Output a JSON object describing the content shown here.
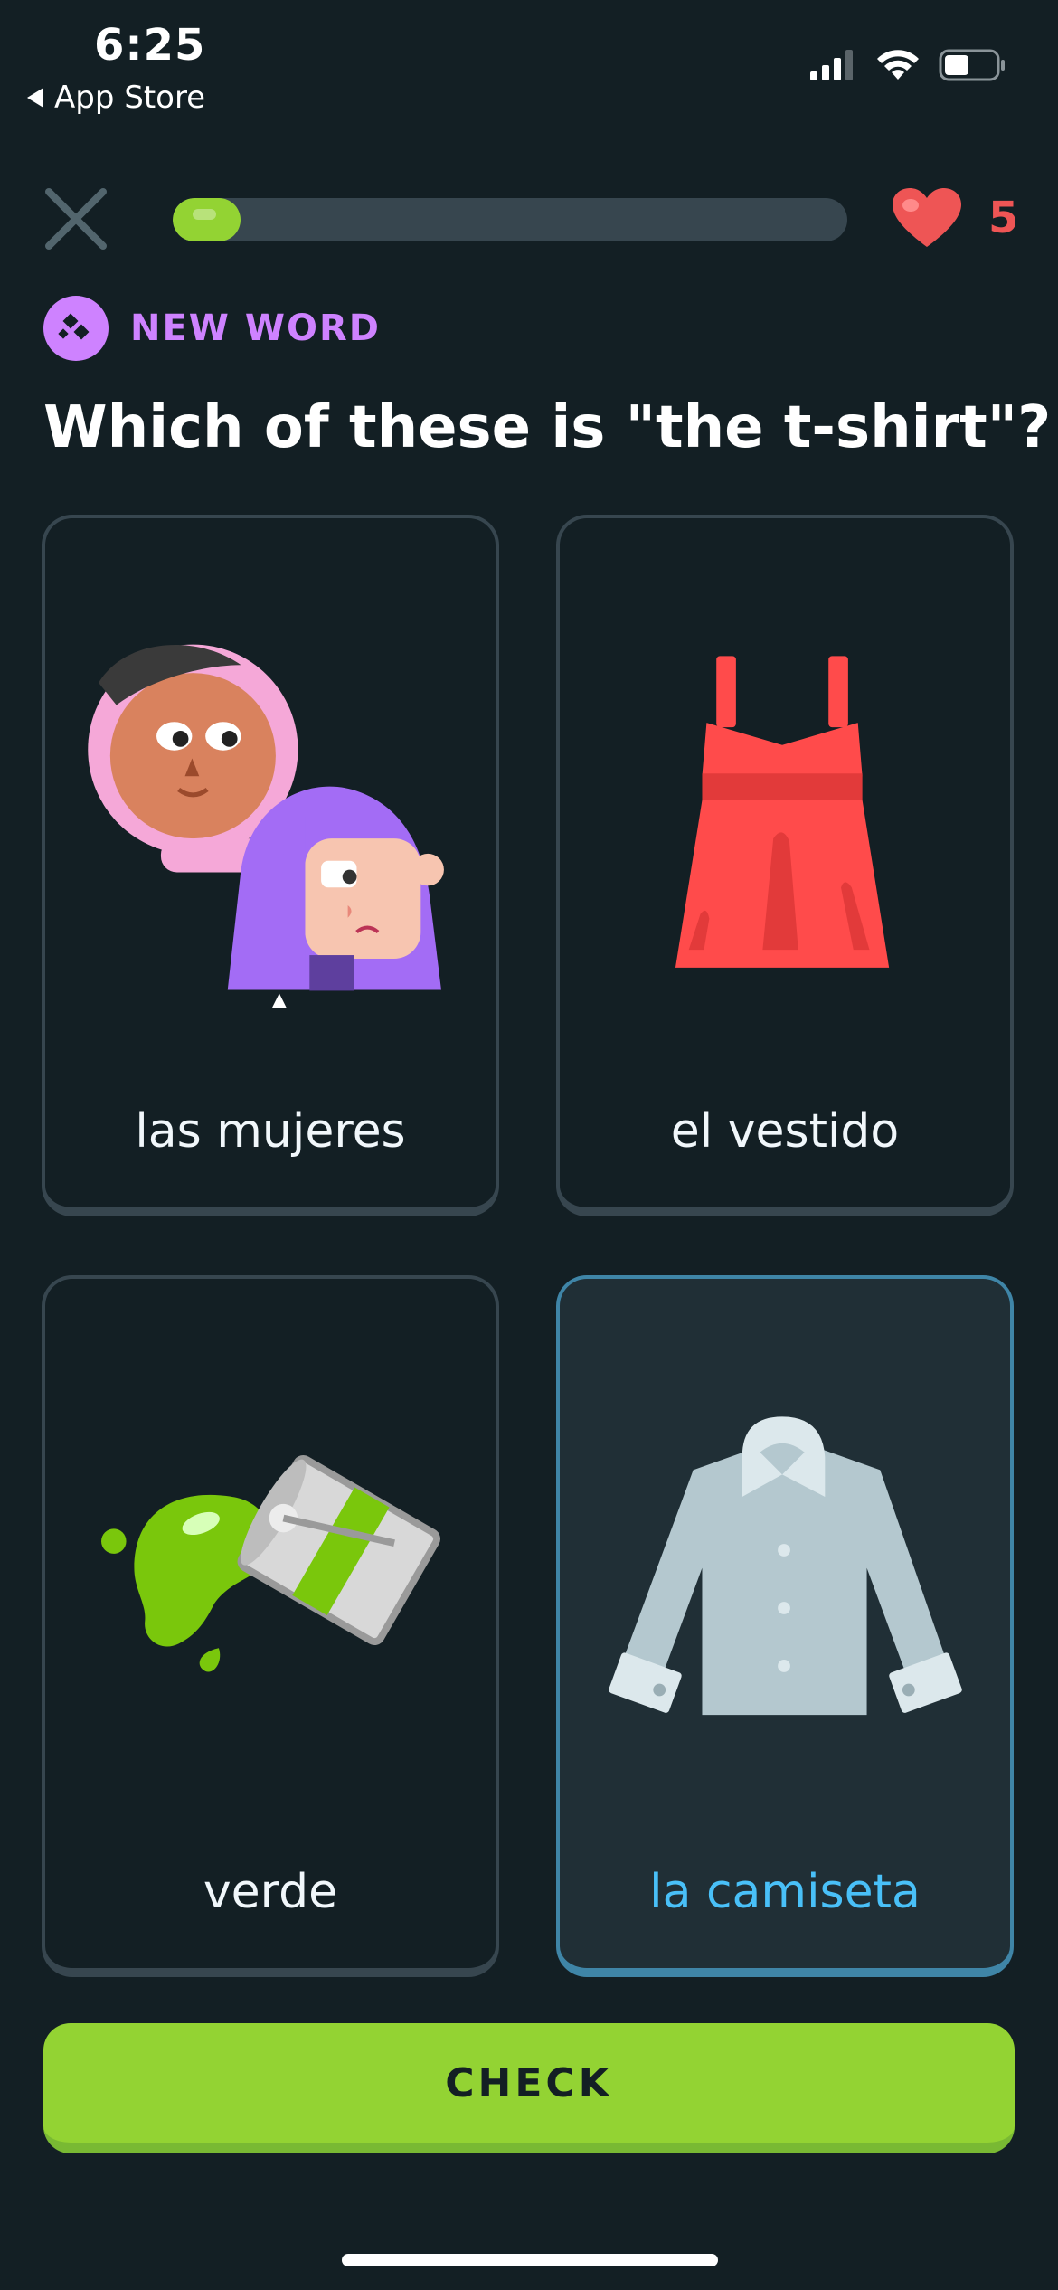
{
  "status_bar": {
    "time": "6:25",
    "back_label": "App Store",
    "icons": [
      "cellular-signal-icon",
      "wifi-icon",
      "battery-icon"
    ]
  },
  "header": {
    "close_icon": "close-icon",
    "progress": 0.1,
    "hearts_icon": "heart-icon",
    "hearts_count": "5"
  },
  "tag": {
    "icon": "new-word-icon",
    "label": "NEW WORD"
  },
  "question": "Which of these is \"the t-shirt\"?",
  "choices": [
    {
      "label": "las mujeres",
      "icon": "women-illustration",
      "selected": false
    },
    {
      "label": "el vestido",
      "icon": "dress-illustration",
      "selected": false
    },
    {
      "label": "verde",
      "icon": "green-paint-illustration",
      "selected": false
    },
    {
      "label": "la camiseta",
      "icon": "shirt-illustration",
      "selected": true
    }
  ],
  "check_button": {
    "label": "CHECK"
  },
  "colors": {
    "background": "#131f24",
    "accent_green": "#93d333",
    "new_word_purple": "#ce82ff",
    "heart_red": "#ee5555",
    "selected_blue": "#49c0f8"
  }
}
